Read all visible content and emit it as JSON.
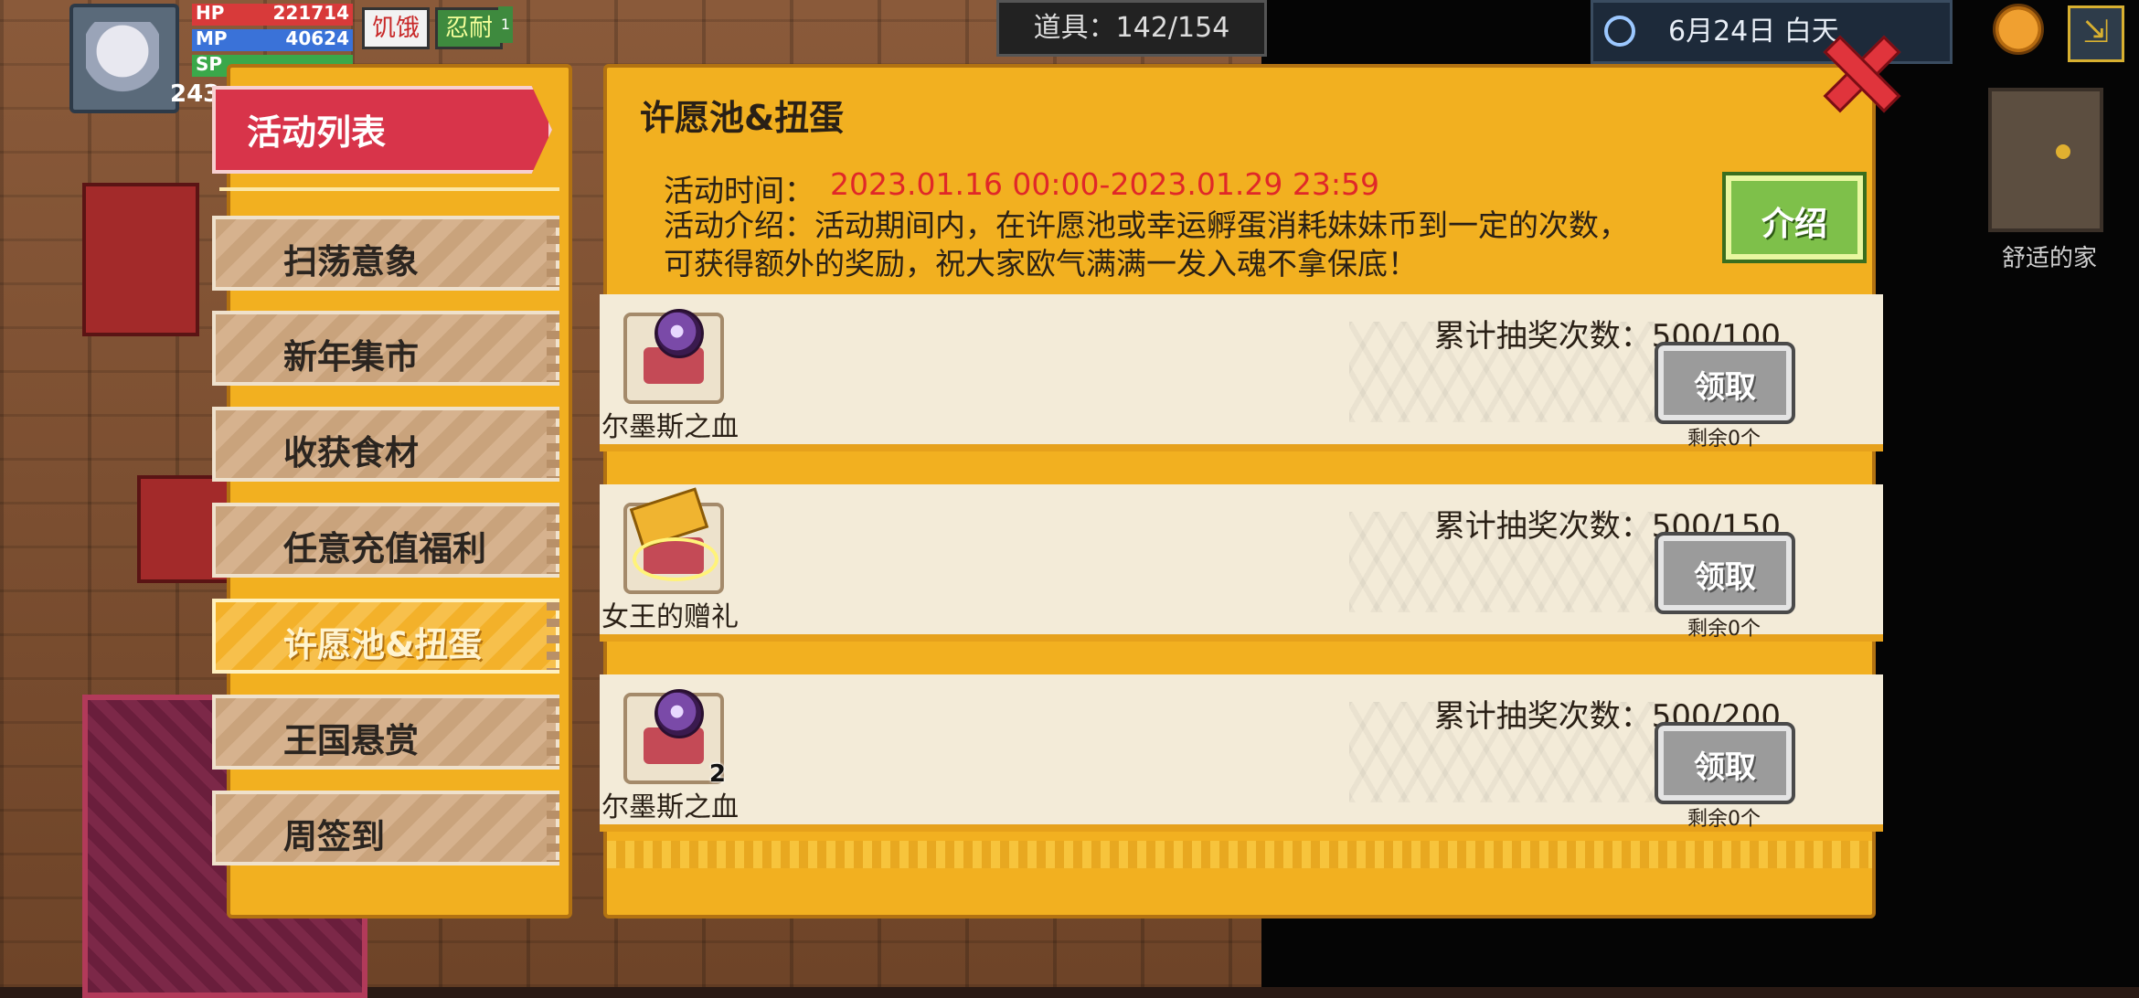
{
  "hud": {
    "level": "243",
    "hp": {
      "label": "HP",
      "value": "221714",
      "fill_fraction": 1.0,
      "color": "#d83a3a"
    },
    "mp": {
      "label": "MP",
      "value": "40624",
      "fill_fraction": 1.0,
      "color": "#3a72d8"
    },
    "sp": {
      "label": "SP",
      "value": "",
      "fill_fraction": 1.0,
      "color": "#3aa84a"
    },
    "status_hunger": "饥饿",
    "status_endure": "忍耐",
    "status_endure_count": "1",
    "items_counter": "道具：142/154",
    "date": "6月24日",
    "time_of_day": "白天",
    "room_label": "舒适的家"
  },
  "left_panel": {
    "title": "活动列表",
    "items": [
      {
        "label": "扫荡意象",
        "active": false
      },
      {
        "label": "新年集市",
        "active": false
      },
      {
        "label": "收获食材",
        "active": false
      },
      {
        "label": "任意充值福利",
        "active": false
      },
      {
        "label": "许愿池&扭蛋",
        "active": true
      },
      {
        "label": "王国悬赏",
        "active": false
      },
      {
        "label": "周签到",
        "active": false
      }
    ]
  },
  "right_panel": {
    "title": "许愿池&扭蛋",
    "time_label": "活动时间：",
    "time_value": "2023.01.16 00:00-2023.01.29 23:59",
    "desc_line1": "活动介绍：活动期间内，在许愿池或幸运孵蛋消耗妹妹币到一定的次数，",
    "desc_line2": "可获得额外的奖励，祝大家欧气满满一发入魂不拿保底！",
    "intro_button": "介绍",
    "rewards": [
      {
        "item_name": "尔墨斯之血",
        "item_icon": "potion-icon",
        "qty": "",
        "progress": "累计抽奖次数：500/100",
        "claim": "领取",
        "remain": "剩余0个"
      },
      {
        "item_name": "女王的赠礼",
        "item_icon": "golden-hammer-icon",
        "qty": "",
        "progress": "累计抽奖次数：500/150",
        "claim": "领取",
        "remain": "剩余0个"
      },
      {
        "item_name": "尔墨斯之血",
        "item_icon": "potion-icon",
        "qty": "2",
        "progress": "累计抽奖次数：500/200",
        "claim": "领取",
        "remain": "剩余0个"
      }
    ]
  }
}
